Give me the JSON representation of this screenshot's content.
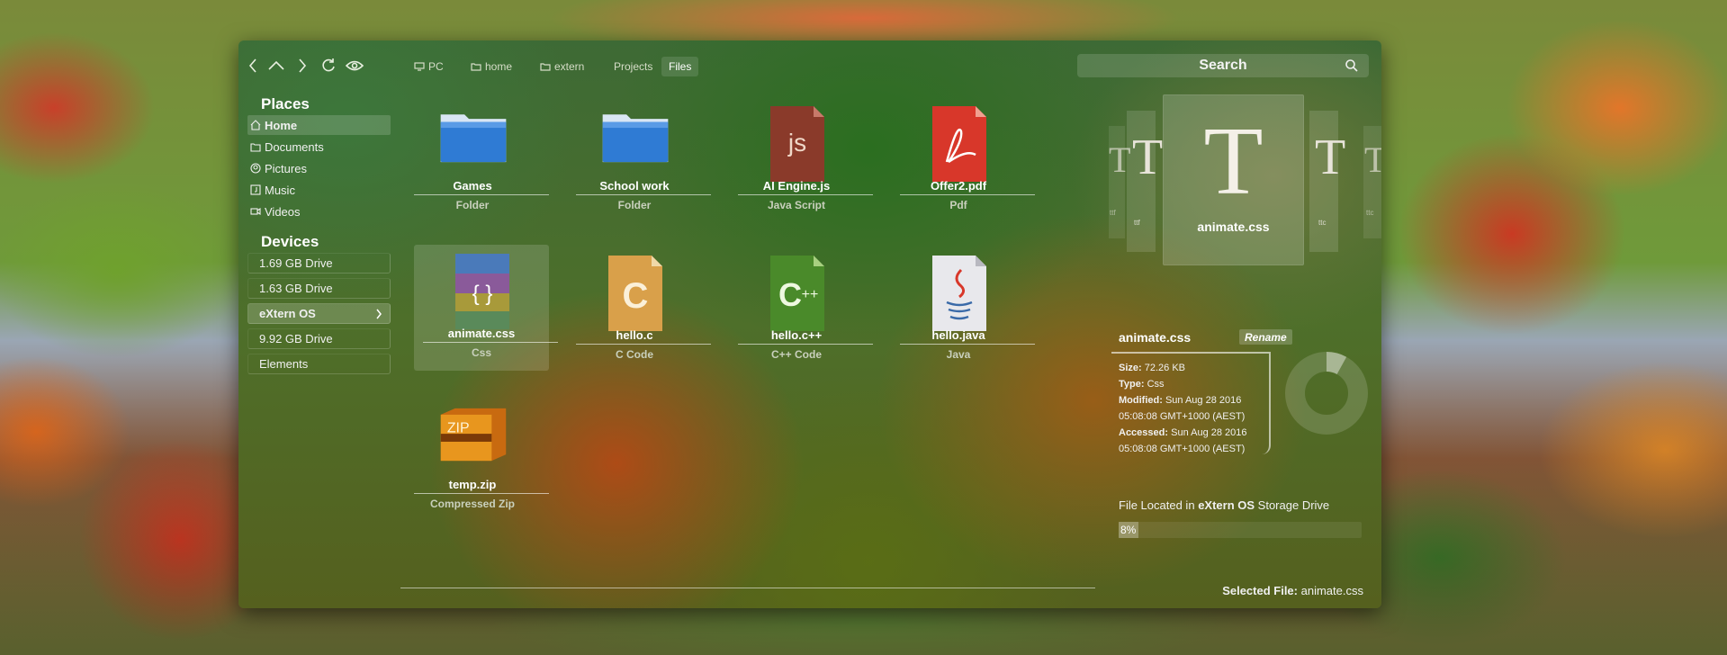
{
  "toolbar": {
    "breadcrumbs": [
      "PC",
      "home",
      "extern",
      "Projects",
      "Files"
    ],
    "search_placeholder": "Search"
  },
  "sidebar": {
    "places_title": "Places",
    "places": [
      {
        "label": "Home",
        "icon": "home-icon"
      },
      {
        "label": "Documents",
        "icon": "folder-icon"
      },
      {
        "label": "Pictures",
        "icon": "user-icon"
      },
      {
        "label": "Music",
        "icon": "music-icon"
      },
      {
        "label": "Videos",
        "icon": "video-icon"
      }
    ],
    "devices_title": "Devices",
    "devices": [
      {
        "label": "1.69 GB Drive"
      },
      {
        "label": "1.63 GB Drive"
      },
      {
        "label": "eXtern OS"
      },
      {
        "label": "9.92 GB Drive"
      },
      {
        "label": "Elements"
      }
    ]
  },
  "files": [
    {
      "name": "Games",
      "type": "Folder",
      "icon": "folder-icon"
    },
    {
      "name": "School work",
      "type": "Folder",
      "icon": "folder-icon"
    },
    {
      "name": "AI Engine.js",
      "type": "Java Script",
      "icon": "js-file-icon"
    },
    {
      "name": "Offer2.pdf",
      "type": "Pdf",
      "icon": "pdf-file-icon"
    },
    {
      "name": "animate.css",
      "type": "Css",
      "icon": "css-file-icon"
    },
    {
      "name": "hello.c",
      "type": "C Code",
      "icon": "c-file-icon"
    },
    {
      "name": "hello.c++",
      "type": "C++ Code",
      "icon": "cpp-file-icon"
    },
    {
      "name": "hello.java",
      "type": "Java",
      "icon": "java-file-icon"
    },
    {
      "name": "temp.zip",
      "type": "Compressed Zip",
      "icon": "zip-file-icon"
    }
  ],
  "preview": {
    "glyph": "T",
    "name": "animate.css",
    "side_labels": [
      "ttf",
      "ttf",
      "ttc",
      "ttc"
    ]
  },
  "details": {
    "name": "animate.css",
    "rename_label": "Rename",
    "size_label": "Size:",
    "size": "72.26 KB",
    "type_label": "Type:",
    "type": "Css",
    "modified_label": "Modified:",
    "modified_1": "Sun Aug 28 2016",
    "modified_2": "05:08:08 GMT+1000 (AEST)",
    "accessed_label": "Accessed:",
    "accessed_1": "Sun Aug 28 2016",
    "accessed_2": "05:08:08 GMT+1000 (AEST)",
    "located_prefix": "File Located in",
    "located_drive": "eXtern OS",
    "located_suffix": "Storage Drive",
    "usage_percent": 8,
    "usage_text": "8%",
    "selected_label": "Selected File:",
    "selected_value": "animate.css"
  },
  "colors": {
    "folder": "#2f7bd4",
    "pdf": "#d8372a",
    "accent": "#ffffff"
  }
}
